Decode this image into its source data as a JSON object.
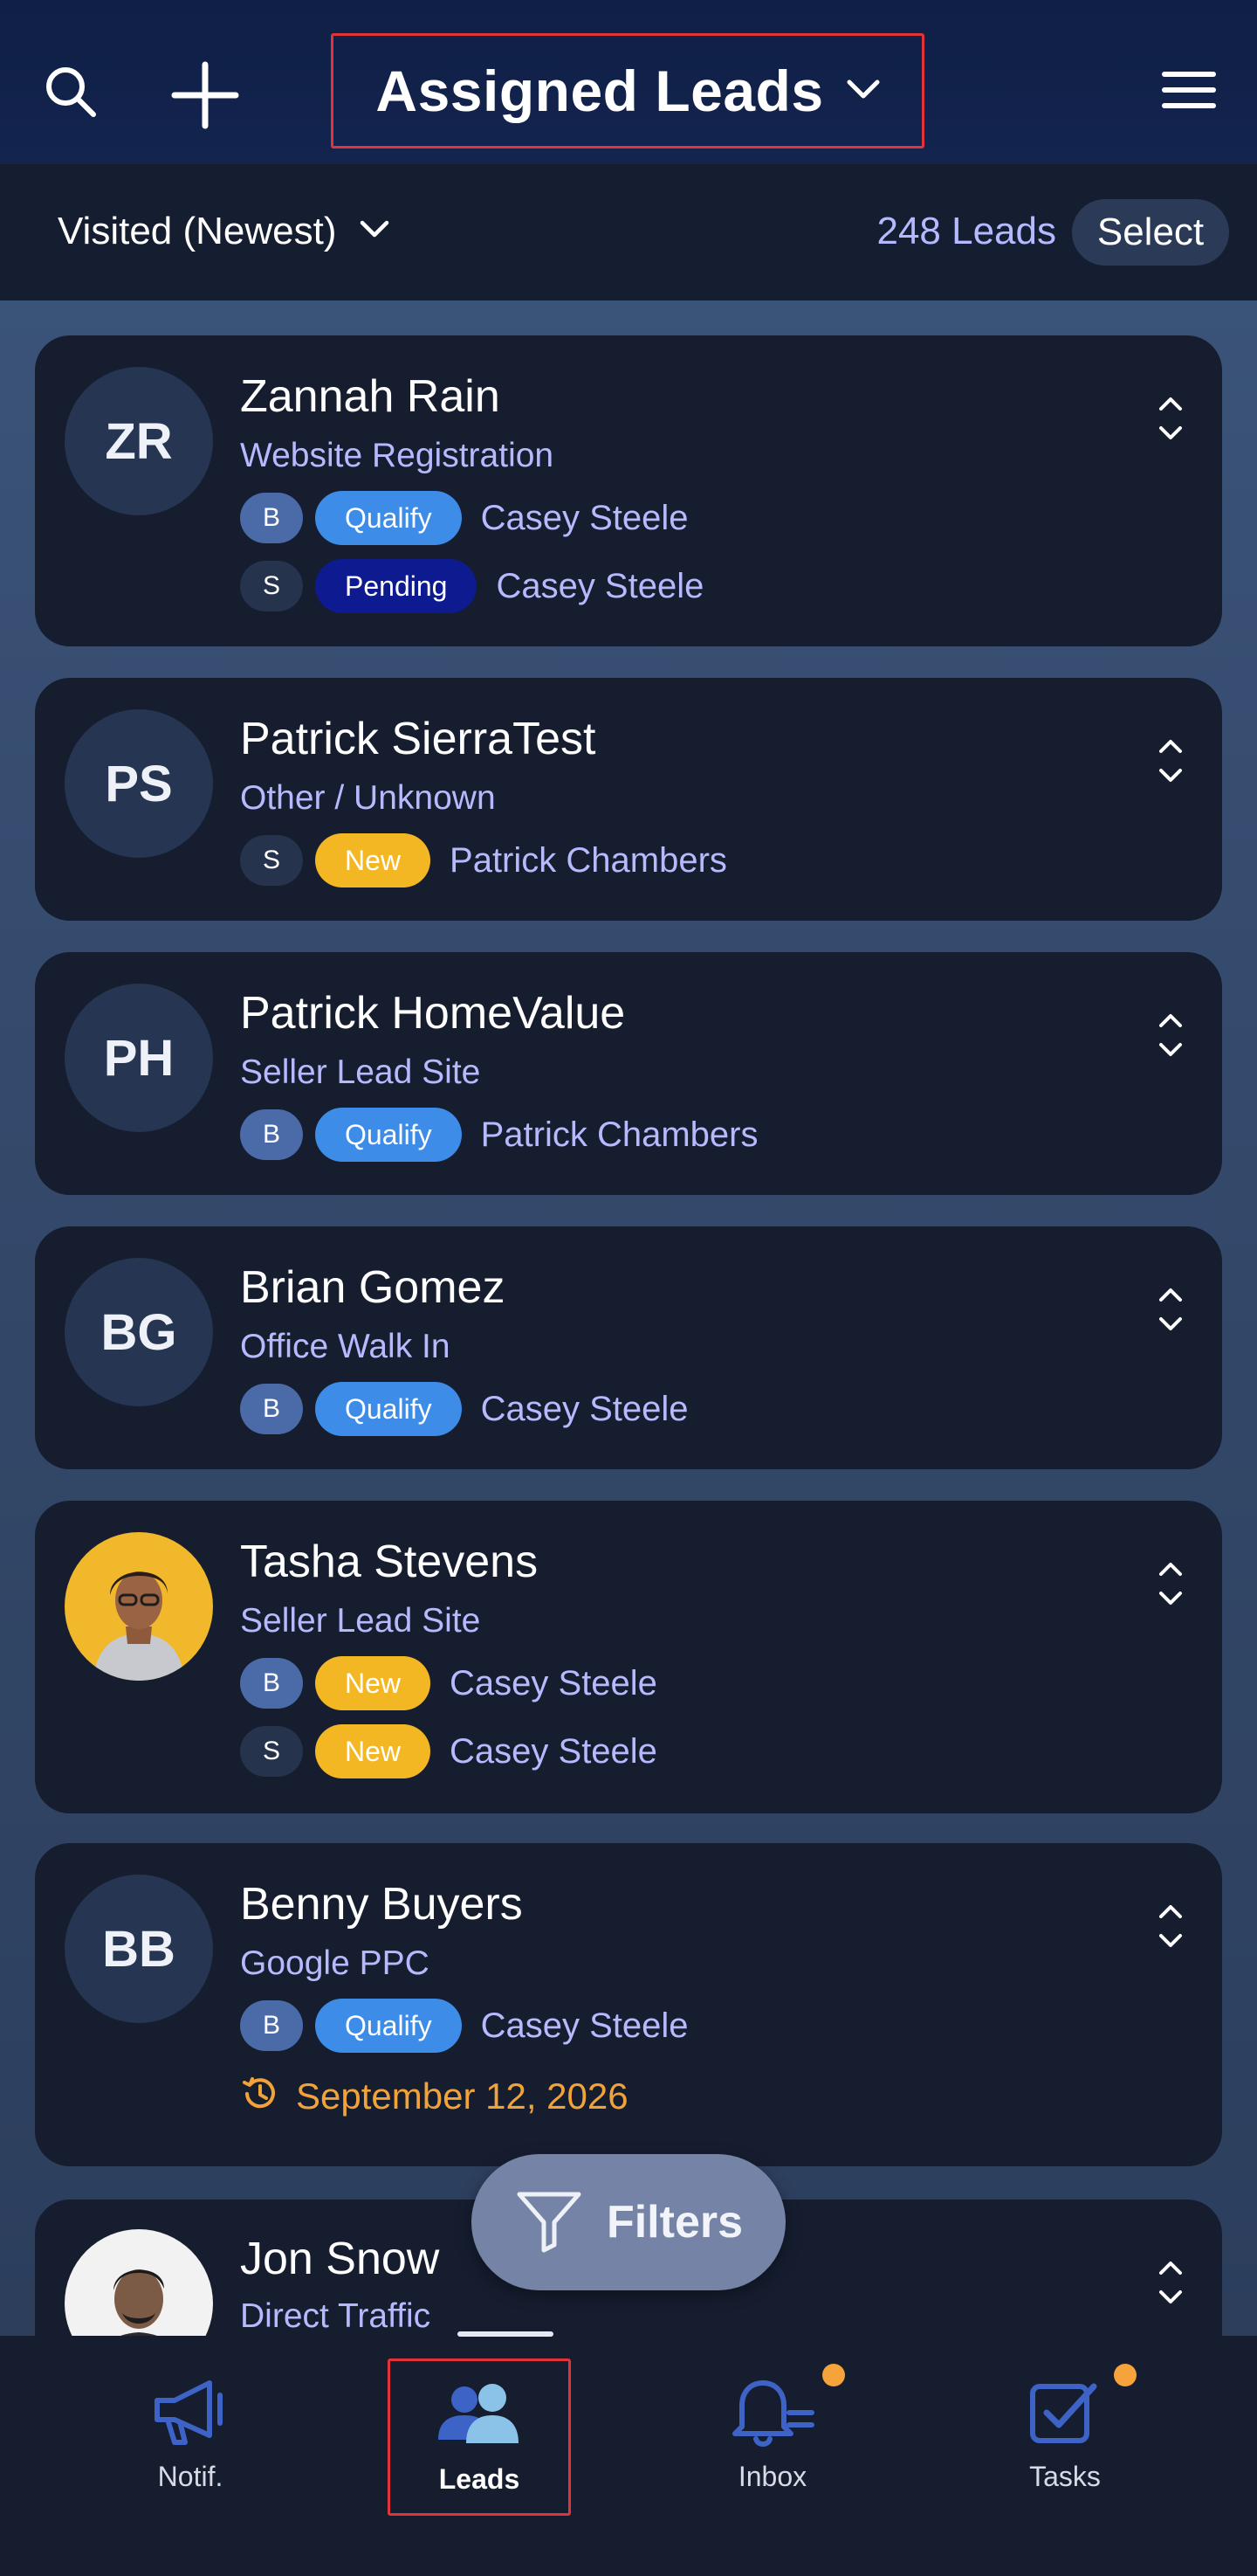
{
  "header": {
    "title": "Assigned Leads",
    "icons": [
      "search-icon",
      "plus-icon",
      "chevron-down-icon",
      "hamburger-menu-icon"
    ]
  },
  "subheader": {
    "sort_label": "Visited (Newest)",
    "count": "248 Leads",
    "select_label": "Select"
  },
  "leads": [
    {
      "initials": "ZR",
      "name": "Zannah Rain",
      "source": "Website Registration",
      "tags": [
        {
          "letter": "B",
          "status": "Qualify",
          "agent": "Casey Steele"
        },
        {
          "letter": "S",
          "status": "Pending",
          "agent": "Casey Steele"
        }
      ]
    },
    {
      "initials": "PS",
      "name": "Patrick SierraTest",
      "source": "Other / Unknown",
      "tags": [
        {
          "letter": "S",
          "status": "New",
          "agent": "Patrick Chambers"
        }
      ]
    },
    {
      "initials": "PH",
      "name": "Patrick HomeValue",
      "source": "Seller Lead Site",
      "tags": [
        {
          "letter": "B",
          "status": "Qualify",
          "agent": "Patrick Chambers"
        }
      ]
    },
    {
      "initials": "BG",
      "name": "Brian Gomez",
      "source": "Office Walk In",
      "tags": [
        {
          "letter": "B",
          "status": "Qualify",
          "agent": "Casey Steele"
        }
      ]
    },
    {
      "initials": "",
      "name": "Tasha Stevens",
      "source": "Seller Lead Site",
      "tags": [
        {
          "letter": "B",
          "status": "New",
          "agent": "Casey Steele"
        },
        {
          "letter": "S",
          "status": "New",
          "agent": "Casey Steele"
        }
      ]
    },
    {
      "initials": "BB",
      "name": "Benny Buyers",
      "source": "Google PPC",
      "tags": [
        {
          "letter": "B",
          "status": "Qualify",
          "agent": "Casey Steele"
        }
      ],
      "date": "September 12, 2026"
    },
    {
      "initials": "",
      "name": "Jon Snow",
      "source": "Direct Traffic",
      "tags": []
    }
  ],
  "filters_label": "Filters",
  "nav": [
    {
      "label": "Notif.",
      "icon": "megaphone-icon"
    },
    {
      "label": "Leads",
      "icon": "people-icon",
      "active": true
    },
    {
      "label": "Inbox",
      "icon": "bell-icon",
      "badge": true
    },
    {
      "label": "Tasks",
      "icon": "checkbox-icon",
      "badge": true
    }
  ],
  "colors": {
    "accent_purple": "#b7b9ff",
    "qualify": "#3c8ce8",
    "pending": "#0e1a8f",
    "new": "#f3b723",
    "date": "#f1a33a",
    "active_outline": "#e2323a"
  }
}
